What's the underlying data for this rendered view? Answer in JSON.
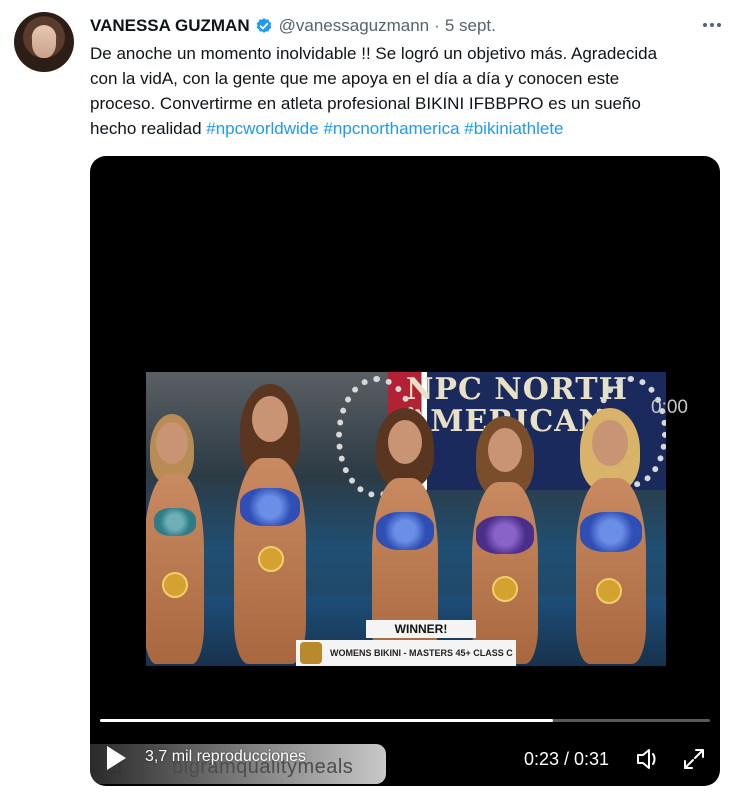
{
  "tweet": {
    "author_name": "VANESSA GUZMAN",
    "author_handle": "@vanessaguzmann",
    "separator": "·",
    "date": "5 sept.",
    "text_line1": "De anoche un momento inolvidable !! Se logró un objetivo más. Agradecida",
    "text_line2": "con la vidA, con la gente que me apoya en el día a día y conocen este",
    "text_line3": "proceso. Convertirme en atleta profesional BIKINI IFBBPRO es un sueño",
    "text_line4_prefix": "hecho realidad ",
    "hashtags": [
      "#npcworldwide",
      "#npcnorthamerica",
      "#bikiniathlete"
    ]
  },
  "video": {
    "banner_text": "NPC NORTH AMERICAN",
    "lower_third_title": "WINNER!",
    "lower_third_class": "WOMENS BIKINI - MASTERS 45+ CLASS C",
    "ghost_time": "0:00",
    "views_label": "3,7 mil reproducciones",
    "current_time": "0:23",
    "time_separator": "/",
    "duration": "0:31",
    "time_display": "0:23 / 0:31",
    "progress_fraction": 0.742,
    "watermark_text": "bigramqualitymeals"
  },
  "colors": {
    "accent": "#1d9bf0",
    "verified": "#1d9bf0",
    "muted": "#536471",
    "text": "#0f1419"
  },
  "icons": {
    "verified": "verified-badge-icon",
    "more": "more-horizontal-icon",
    "play": "play-icon",
    "volume": "volume-icon",
    "fullscreen": "fullscreen-icon"
  }
}
